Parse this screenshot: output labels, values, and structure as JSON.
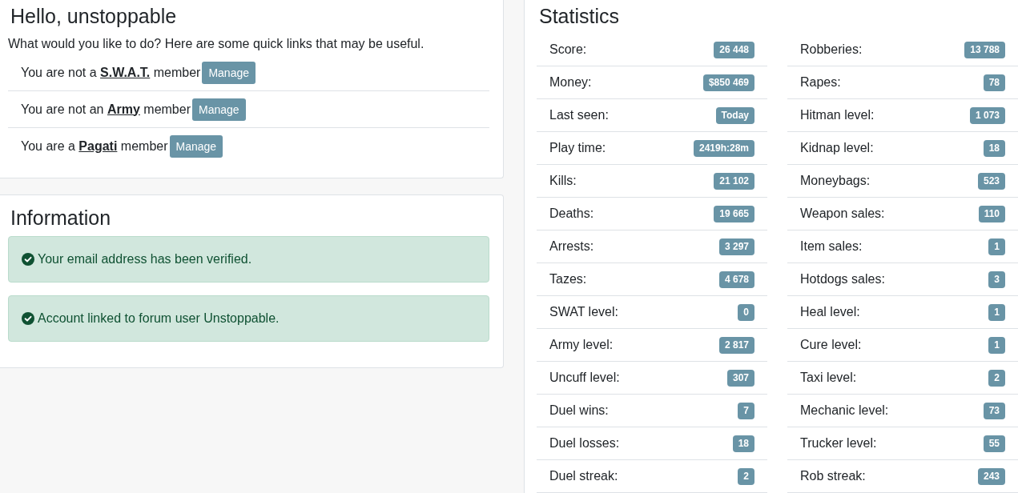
{
  "greeting": {
    "title": "Hello, unstoppable",
    "intro": "What would you like to do? Here are some quick links that may be useful.",
    "memberships": [
      {
        "prefix": "You are not a",
        "group": "S.W.A.T.",
        "suffix": "member",
        "button": "Manage"
      },
      {
        "prefix": "You are not an",
        "group": "Army",
        "suffix": "member",
        "button": "Manage"
      },
      {
        "prefix": "You are a",
        "group": "Pagati",
        "suffix": "member",
        "button": "Manage"
      }
    ]
  },
  "information": {
    "title": "Information",
    "alerts": [
      {
        "text": "Your email address has been verified."
      },
      {
        "text": "Account linked to forum user Unstoppable."
      }
    ]
  },
  "statistics": {
    "title": "Statistics",
    "columns": [
      {
        "rows": [
          {
            "label": "Score:",
            "value": "26 448"
          },
          {
            "label": "Money:",
            "value": "$850 469"
          },
          {
            "label": "Last seen:",
            "value": "Today"
          },
          {
            "label": "Play time:",
            "value": "2419h:28m"
          },
          {
            "label": "Kills:",
            "value": "21 102"
          },
          {
            "label": "Deaths:",
            "value": "19 665"
          },
          {
            "label": "Arrests:",
            "value": "3 297"
          },
          {
            "label": "Tazes:",
            "value": "4 678"
          },
          {
            "label": "SWAT level:",
            "value": "0"
          },
          {
            "label": "Army level:",
            "value": "2 817"
          },
          {
            "label": "Uncuff level:",
            "value": "307"
          },
          {
            "label": "Duel wins:",
            "value": "7"
          },
          {
            "label": "Duel losses:",
            "value": "18"
          },
          {
            "label": "Duel streak:",
            "value": "2"
          }
        ]
      },
      {
        "rows": [
          {
            "label": "Robberies:",
            "value": "13 788"
          },
          {
            "label": "Rapes:",
            "value": "78"
          },
          {
            "label": "Hitman level:",
            "value": "1 073"
          },
          {
            "label": "Kidnap level:",
            "value": "18"
          },
          {
            "label": "Moneybags:",
            "value": "523"
          },
          {
            "label": "Weapon sales:",
            "value": "110"
          },
          {
            "label": "Item sales:",
            "value": "1"
          },
          {
            "label": "Hotdogs sales:",
            "value": "3"
          },
          {
            "label": "Heal level:",
            "value": "1"
          },
          {
            "label": "Cure level:",
            "value": "1"
          },
          {
            "label": "Taxi level:",
            "value": "2"
          },
          {
            "label": "Mechanic level:",
            "value": "73"
          },
          {
            "label": "Trucker level:",
            "value": "55"
          },
          {
            "label": "Rob streak:",
            "value": "243"
          }
        ]
      }
    ]
  }
}
